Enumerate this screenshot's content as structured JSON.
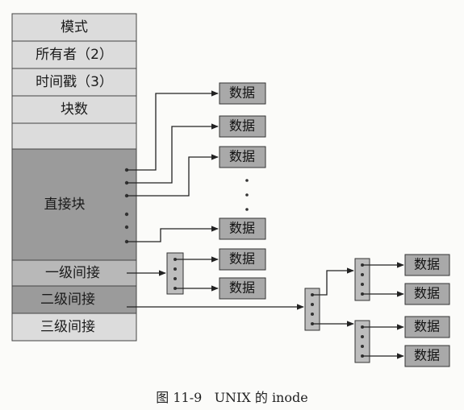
{
  "inode": {
    "fields": [
      {
        "label": "模式"
      },
      {
        "label": "所有者（2）"
      },
      {
        "label": "时间戳（3）"
      },
      {
        "label": "块数"
      },
      {
        "label": ""
      },
      {
        "label": "直接块"
      },
      {
        "label": "一级间接"
      },
      {
        "label": "二级间接"
      },
      {
        "label": "三级间接"
      }
    ]
  },
  "data_block_label": "数据",
  "caption": "图 11-9   UNIX 的 inode",
  "colors": {
    "light_cell": "#dcdcdc",
    "dark_cell": "#9b9b9b",
    "mid_cell": "#b8b8b8",
    "data_block": "#a9a9a9",
    "index_block": "#bdbdbd",
    "dot": "#333333",
    "line": "#222222"
  }
}
